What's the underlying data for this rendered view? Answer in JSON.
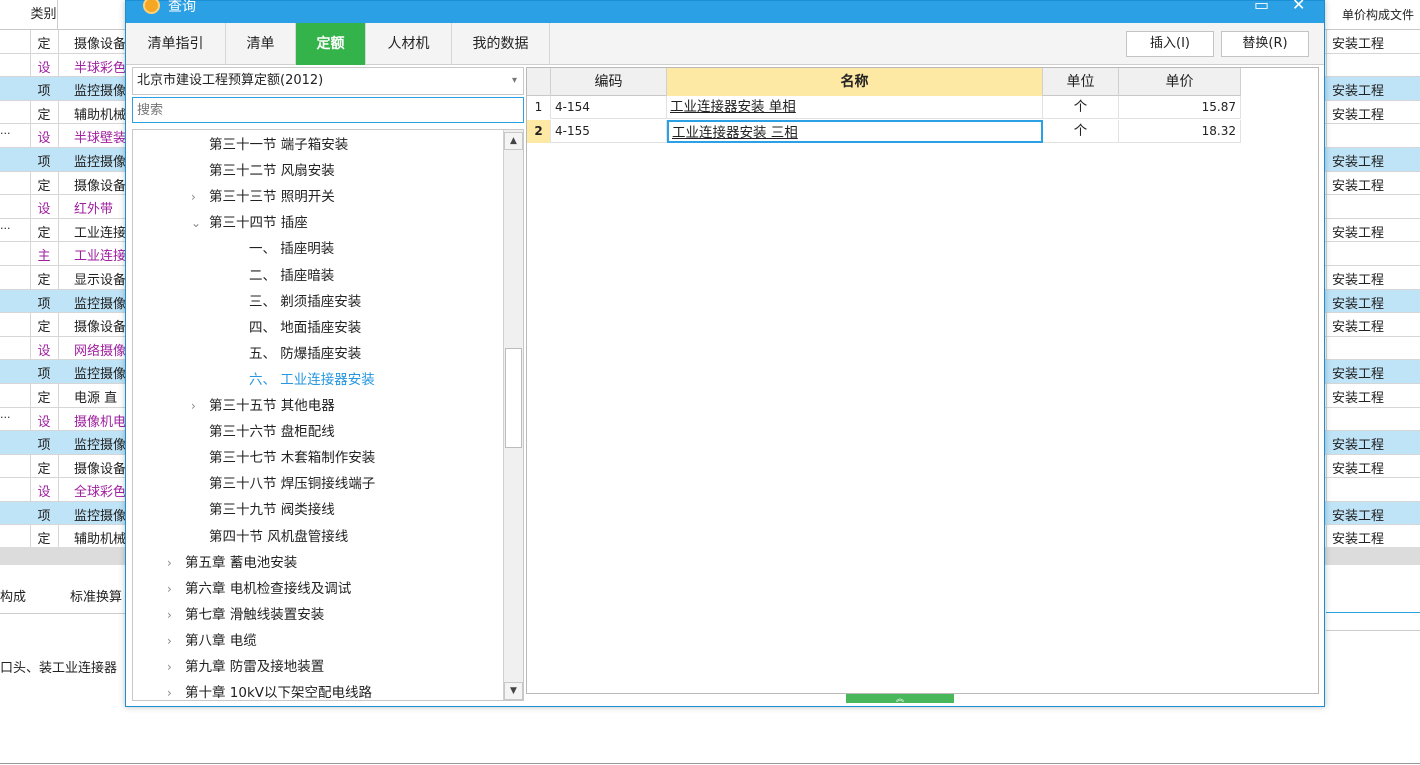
{
  "background": {
    "header_type": "类别",
    "header_right": "单价构成文件",
    "rows": [
      {
        "dots": "",
        "type": "定",
        "name": "摄像设备",
        "right": "安装工程",
        "blue": false,
        "purple": false
      },
      {
        "dots": "",
        "type": "设",
        "name": "半球彩色",
        "right": "",
        "blue": false,
        "purple": true
      },
      {
        "dots": "",
        "type": "项",
        "name": "监控摄像",
        "right": "安装工程",
        "blue": true,
        "purple": false
      },
      {
        "dots": "",
        "type": "定",
        "name": "辅助机械",
        "right": "安装工程",
        "blue": false,
        "purple": false
      },
      {
        "dots": "···",
        "type": "设",
        "name": "半球壁装",
        "right": "",
        "blue": false,
        "purple": true
      },
      {
        "dots": "",
        "type": "项",
        "name": "监控摄像",
        "right": "安装工程",
        "blue": true,
        "purple": false
      },
      {
        "dots": "",
        "type": "定",
        "name": "摄像设备",
        "right": "安装工程",
        "blue": false,
        "purple": false
      },
      {
        "dots": "",
        "type": "设",
        "name": "红外带",
        "right": "",
        "blue": false,
        "purple": true
      },
      {
        "dots": "···",
        "type": "定",
        "name": "工业连接",
        "right": "安装工程",
        "blue": false,
        "purple": false
      },
      {
        "dots": "",
        "type": "主",
        "name": "工业连接",
        "right": "",
        "blue": false,
        "purple": true
      },
      {
        "dots": "",
        "type": "定",
        "name": "显示设备",
        "right": "安装工程",
        "blue": false,
        "purple": false
      },
      {
        "dots": "",
        "type": "项",
        "name": "监控摄像",
        "right": "安装工程",
        "blue": true,
        "purple": false
      },
      {
        "dots": "",
        "type": "定",
        "name": "摄像设备",
        "right": "安装工程",
        "blue": false,
        "purple": false
      },
      {
        "dots": "",
        "type": "设",
        "name": "网络摄像",
        "right": "",
        "blue": false,
        "purple": true
      },
      {
        "dots": "",
        "type": "项",
        "name": "监控摄像",
        "right": "安装工程",
        "blue": true,
        "purple": false
      },
      {
        "dots": "",
        "type": "定",
        "name": "电源 直",
        "right": "安装工程",
        "blue": false,
        "purple": false
      },
      {
        "dots": "···",
        "type": "设",
        "name": "摄像机电",
        "right": "",
        "blue": false,
        "purple": true
      },
      {
        "dots": "",
        "type": "项",
        "name": "监控摄像",
        "right": "安装工程",
        "blue": true,
        "purple": false
      },
      {
        "dots": "",
        "type": "定",
        "name": "摄像设备",
        "right": "安装工程",
        "blue": false,
        "purple": false
      },
      {
        "dots": "",
        "type": "设",
        "name": "全球彩色",
        "right": "",
        "blue": false,
        "purple": true
      },
      {
        "dots": "",
        "type": "项",
        "name": "监控摄像",
        "right": "安装工程",
        "blue": true,
        "purple": false
      },
      {
        "dots": "",
        "type": "定",
        "name": "辅助机械",
        "right": "安装工程",
        "blue": false,
        "purple": false
      }
    ],
    "tab1": "构成",
    "tab2": "标准换算",
    "description": "口头、装工业连接器"
  },
  "dialog": {
    "title": "查询",
    "minimize": "▭",
    "close": "✕",
    "tabs": [
      "清单指引",
      "清单",
      "定额",
      "人材机",
      "我的数据"
    ],
    "insert_label": "插入(I)",
    "replace_label": "替换(R)",
    "library": "北京市建设工程预算定额(2012)",
    "search_placeholder": "搜索",
    "tree": [
      {
        "label": "第三十一节 端子箱安装",
        "chev": "",
        "level": 2,
        "selected": false
      },
      {
        "label": "第三十二节 风扇安装",
        "chev": "",
        "level": 2,
        "selected": false
      },
      {
        "label": "第三十三节 照明开关",
        "chev": "›",
        "level": 2,
        "selected": false
      },
      {
        "label": "第三十四节 插座",
        "chev": "⌄",
        "level": 2,
        "selected": false
      },
      {
        "label": "一、 插座明装",
        "chev": "",
        "level": 3,
        "selected": false
      },
      {
        "label": "二、 插座暗装",
        "chev": "",
        "level": 3,
        "selected": false
      },
      {
        "label": "三、 剃须插座安装",
        "chev": "",
        "level": 3,
        "selected": false
      },
      {
        "label": "四、 地面插座安装",
        "chev": "",
        "level": 3,
        "selected": false
      },
      {
        "label": "五、 防爆插座安装",
        "chev": "",
        "level": 3,
        "selected": false
      },
      {
        "label": "六、 工业连接器安装",
        "chev": "",
        "level": 3,
        "selected": true
      },
      {
        "label": "第三十五节 其他电器",
        "chev": "›",
        "level": 2,
        "selected": false
      },
      {
        "label": "第三十六节 盘柜配线",
        "chev": "",
        "level": 2,
        "selected": false
      },
      {
        "label": "第三十七节 木套箱制作安装",
        "chev": "",
        "level": 2,
        "selected": false
      },
      {
        "label": "第三十八节 焊压铜接线端子",
        "chev": "",
        "level": 2,
        "selected": false
      },
      {
        "label": "第三十九节 阀类接线",
        "chev": "",
        "level": 2,
        "selected": false
      },
      {
        "label": "第四十节 风机盘管接线",
        "chev": "",
        "level": 2,
        "selected": false
      },
      {
        "label": "第五章 蓄电池安装",
        "chev": "›",
        "level": 1,
        "selected": false
      },
      {
        "label": "第六章 电机检查接线及调试",
        "chev": "›",
        "level": 1,
        "selected": false
      },
      {
        "label": "第七章 滑触线装置安装",
        "chev": "›",
        "level": 1,
        "selected": false
      },
      {
        "label": "第八章 电缆",
        "chev": "›",
        "level": 1,
        "selected": false
      },
      {
        "label": "第九章 防雷及接地装置",
        "chev": "›",
        "level": 1,
        "selected": false
      },
      {
        "label": "第十章 10kV以下架空配电线路",
        "chev": "›",
        "level": 1,
        "selected": false
      }
    ],
    "scroll_up": "▲",
    "scroll_down": "▼",
    "grid_headers": {
      "code": "编码",
      "name": "名称",
      "unit": "单位",
      "price": "单价"
    },
    "grid_rows": [
      {
        "idx": "1",
        "code": "4-154",
        "name": "工业连接器安装 单相",
        "unit": "个",
        "price": "15.87"
      },
      {
        "idx": "2",
        "code": "4-155",
        "name": "工业连接器安装 三相",
        "unit": "个",
        "price": "18.32"
      }
    ],
    "collapse": "︽"
  }
}
